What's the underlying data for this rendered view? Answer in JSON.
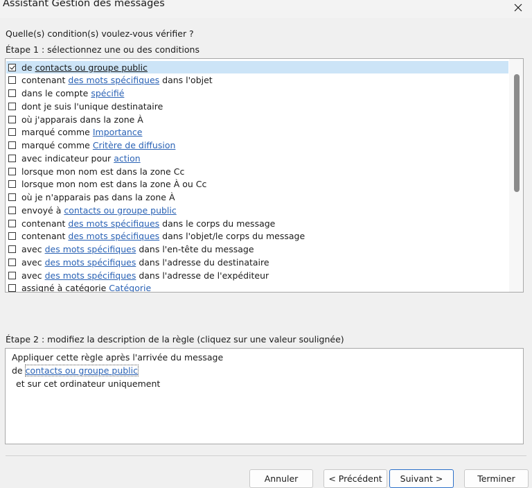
{
  "window": {
    "title": "Assistant Gestion des messages",
    "close_glyph": "✕"
  },
  "question": "Quelle(s) condition(s) voulez-vous vérifier ?",
  "step1_label": "Étape 1 : sélectionnez une ou des conditions",
  "conditions": [
    {
      "checked": true,
      "before": "de ",
      "link": "contacts ou groupe public",
      "after": ""
    },
    {
      "checked": false,
      "before": "contenant ",
      "link": "des mots spécifiques",
      "after": " dans l'objet"
    },
    {
      "checked": false,
      "before": "dans le compte ",
      "link": "spécifié",
      "after": ""
    },
    {
      "checked": false,
      "before": "dont je suis l'unique destinataire",
      "link": "",
      "after": ""
    },
    {
      "checked": false,
      "before": "où j'apparais dans la zone À",
      "link": "",
      "after": ""
    },
    {
      "checked": false,
      "before": "marqué comme ",
      "link": "Importance",
      "after": ""
    },
    {
      "checked": false,
      "before": "marqué comme ",
      "link": "Critère de diffusion",
      "after": ""
    },
    {
      "checked": false,
      "before": "avec indicateur pour ",
      "link": "action ",
      "after": ""
    },
    {
      "checked": false,
      "before": "lorsque mon nom est dans la zone Cc",
      "link": "",
      "after": ""
    },
    {
      "checked": false,
      "before": "lorsque mon nom est dans la zone À ou Cc",
      "link": "",
      "after": ""
    },
    {
      "checked": false,
      "before": "où je n'apparais pas dans la zone À",
      "link": "",
      "after": ""
    },
    {
      "checked": false,
      "before": "envoyé à ",
      "link": "contacts ou groupe public",
      "after": ""
    },
    {
      "checked": false,
      "before": "contenant ",
      "link": "des mots spécifiques",
      "after": " dans le corps du message"
    },
    {
      "checked": false,
      "before": "contenant ",
      "link": "des mots spécifiques",
      "after": " dans l'objet/le corps du message"
    },
    {
      "checked": false,
      "before": "avec ",
      "link": "des mots spécifiques",
      "after": " dans l'en-tête du message"
    },
    {
      "checked": false,
      "before": "avec ",
      "link": "des mots spécifiques",
      "after": " dans l'adresse du destinataire"
    },
    {
      "checked": false,
      "before": "avec ",
      "link": "des mots spécifiques",
      "after": " dans l'adresse de l'expéditeur"
    },
    {
      "checked": false,
      "before": "assigné à catégorie ",
      "link": "Catégorie",
      "after": ""
    }
  ],
  "step2_label": "Étape 2 : modifiez la description de la règle (cliquez sur une valeur soulignée)",
  "description": {
    "line1": "Appliquer cette règle après l'arrivée du message",
    "line2_prefix": "de ",
    "line2_link": "contacts ou groupe public",
    "line3": "et sur cet ordinateur uniquement"
  },
  "buttons": {
    "cancel": "Annuler",
    "previous": "< Précédent",
    "next": "Suivant >",
    "finish": "Terminer"
  }
}
